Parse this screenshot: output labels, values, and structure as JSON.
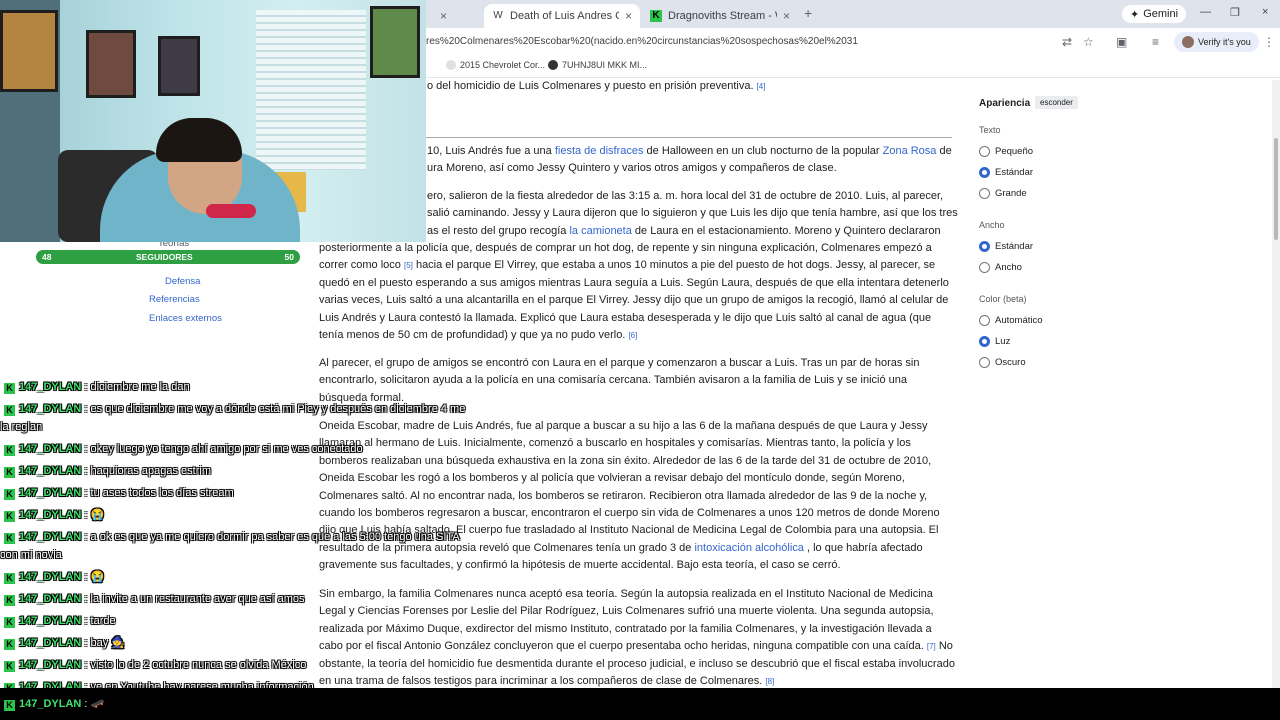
{
  "browser": {
    "tabs": [
      {
        "favicon": "W",
        "title": "Death of Luis Andres Colmenares",
        "active": true
      },
      {
        "favicon": "K",
        "title": "Dragnoviths Stream - Watch Li",
        "active": false
      }
    ],
    "new_tab": "+",
    "gemini": "Gemini",
    "url": "res%20Colmenares%20Escobar%20(nacido.en%20circunstancias%20sospechosas%20el%2031",
    "verify": "Verify it's you",
    "bookmarks": [
      "2015 Chevrolet Cor...",
      "7UHNJ8UI MKK MI..."
    ],
    "close_x": "×"
  },
  "article": {
    "p0": "o del homicidio de Luis Colmenares y puesto en prisión preventiva.",
    "p0_ref": "[4]",
    "p1a": "10, Luis Andrés fue a una ",
    "p1_link1": "fiesta de disfraces",
    "p1b": " de Halloween en un club nocturno de la popular ",
    "p1_link2": "Zona Rosa",
    "p1c": " de",
    "p1d": "ura Moreno, así como Jessy Quintero y varios otros amigos y compañeros de clase.",
    "p2a": "ero, salieron de la fiesta alrededor de las 3:15 a. m. hora local del 31 de octubre de 2010. Luis, al parecer,",
    "p2b": "salió caminando. Jessy y Laura dijeron que lo siguieron y que Luis les dijo que tenía hambre, así que los tres",
    "p2c": "as el resto del grupo recogía ",
    "p2_link": "la camioneta",
    "p2d": " de Laura en el estacionamiento. Moreno y Quintero declararon",
    "p3a": "posteriormente a la policía que, después de comprar un hot dog, de repente y sin ninguna explicación, Colmenares empezó a correr como loco ",
    "p3_ref1": "[5]",
    "p3b": " hacia el parque El Virrey, que estaba a unos 10 minutos a pie del puesto de hot dogs. Jessy, al parecer, se quedó en el puesto esperando a sus amigos mientras Laura seguía a Luis. Según Laura, después de que ella intentara detenerlo varias veces, Luis saltó a una alcantarilla en el parque El Virrey. Jessy dijo que un grupo de amigos la recogió, llamó al celular de Luis Andrés y Laura contestó la llamada. Explicó que Laura estaba desesperada y le dijo que Luis saltó al canal de agua (que tenía menos de 50 cm de profundidad) y que ya no pudo verlo.",
    "p3_ref2": "[6]",
    "p4": "Al parecer, el grupo de amigos se encontró con Laura en el parque y comenzaron a buscar a Luis. Tras un par de horas sin encontrarlo, solicitaron ayuda a la policía en una comisaría cercana. También avisaron a la familia de Luis y se inició una búsqueda formal.",
    "p5a": "Oneida Escobar, madre de Luis Andrés, fue al parque a buscar a su hijo a las 6 de la mañana después de que Laura y Jessy llamaran al hermano de Luis. Inicialmente, comenzó a buscarlo en hospitales y comisarías. Mientras tanto, la policía y los bomberos realizaban una búsqueda exhaustiva en la zona sin éxito. Alrededor de las 6 de la tarde del 31 de octubre de 2010, Oneida Escobar les rogó a los bomberos y al policía que volvieran a revisar debajo del montículo donde, según Moreno, Colmenares saltó. Al no encontrar nada, los bomberos se retiraron. Recibieron otra llamada alrededor de las 9 de la noche y, cuando los bomberos regresaron a buscar, encontraron el cuerpo sin vida de Colmenares a unos 120 metros de donde Moreno dijo que Luis había saltado. El cuerpo fue trasladado al Instituto Nacional de Medicina Legal de Colombia para una autopsia. El resultado de la primera autopsia reveló que Colmenares tenía un grado 3 de ",
    "p5_link": "intoxicación alcohólica",
    "p5b": " , lo que habría afectado gravemente sus facultades, y confirmó la hipótesis de muerte accidental. Bajo esta teoría, el caso se cerró.",
    "p6a": "Sin embargo, la familia Colmenares nunca aceptó esa teoría. Según la autopsia realizada en el Instituto Nacional de Medicina Legal y Ciencias Forenses por Leslie del Pilar Rodríguez, Luis Colmenares sufrió una muerte violenta. Una segunda autopsia, realizada por Máximo Duque, exdirector del mismo Instituto, contratado por la familia Colmenares, y la investigación llevada a cabo por el fiscal Antonio González concluyeron que el cuerpo presentaba ocho heridas, ninguna compatible con una caída.",
    "p6_ref1": "[7]",
    "p6b": " No obstante, la teoría del homicidio fue desmentida durante el proceso judicial, e incluso se descubrió que el fiscal estaba involucrado en una trama de falsos testigos para incriminar a los compañeros de clase de Colmenares.",
    "p6_ref2": "[8]"
  },
  "toc": {
    "teorias": "Teorías",
    "defensa": "Defensa",
    "referencias": "Referencias",
    "enlaces": "Enlaces externos"
  },
  "appearance": {
    "title": "Apariencia",
    "hide": "esconder",
    "text_label": "Texto",
    "text_options": [
      "Pequeño",
      "Estándar",
      "Grande"
    ],
    "text_selected": "Estándar",
    "width_label": "Ancho",
    "width_options": [
      "Estándar",
      "Ancho"
    ],
    "width_selected": "Estándar",
    "color_label": "Color (beta)",
    "color_options": [
      "Automático",
      "Luz",
      "Oscuro"
    ],
    "color_selected": "Luz"
  },
  "goal": {
    "left": "48",
    "label": "SEGUIDORES",
    "right": "50"
  },
  "chat": {
    "username": "147_DYLAN",
    "messages": [
      ": diciembre me la dan",
      ": es que diciembre me voy a dónde está mi Piey y después en diciembre 4 me la reglan",
      ": okey luego yo tengo ahí amigo por si me ves conectado",
      ": haquioras apagas estrim",
      ": tu ases todos los días stream",
      ": 😭",
      ": a ok es que ya me quiero dormir pa saber es que a las 5:00 tengo una SITA con mi novia",
      ": 😭",
      ": la invite a un restaurante aver que así amos",
      ": tarde",
      ": bay 🧙",
      ": visto lo de 2 octubre nunca se olvida México",
      ": ve en Youtube hay parese mucha información",
      ": 🛹"
    ]
  },
  "colors": {
    "accent": "#3366cc",
    "goal": "#2ea043",
    "chat_name": "#3fe26b"
  }
}
